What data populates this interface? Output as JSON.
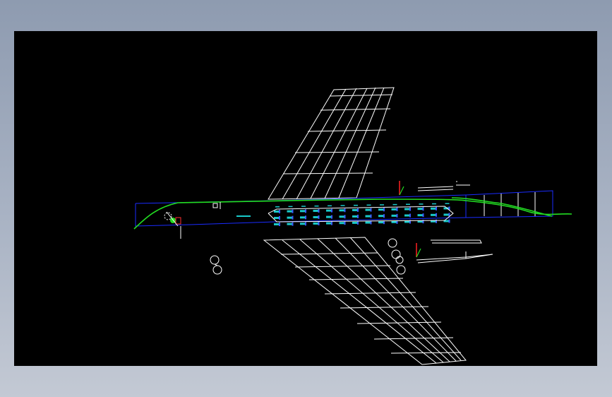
{
  "window": {
    "background_gradient": [
      "#8e9bb0",
      "#c3c9d4"
    ]
  },
  "viewport": {
    "background": "#000000"
  },
  "model": {
    "description_colors": {
      "wireframe": "#ffffff",
      "fuselage_outline": "#1a2cff",
      "contour_line": "#22dd22",
      "seats": "#19c9c9",
      "axis_x": "#ff2020",
      "axis_y": "#22dd22"
    },
    "seat_rows": 14,
    "seats_per_row": 3
  }
}
